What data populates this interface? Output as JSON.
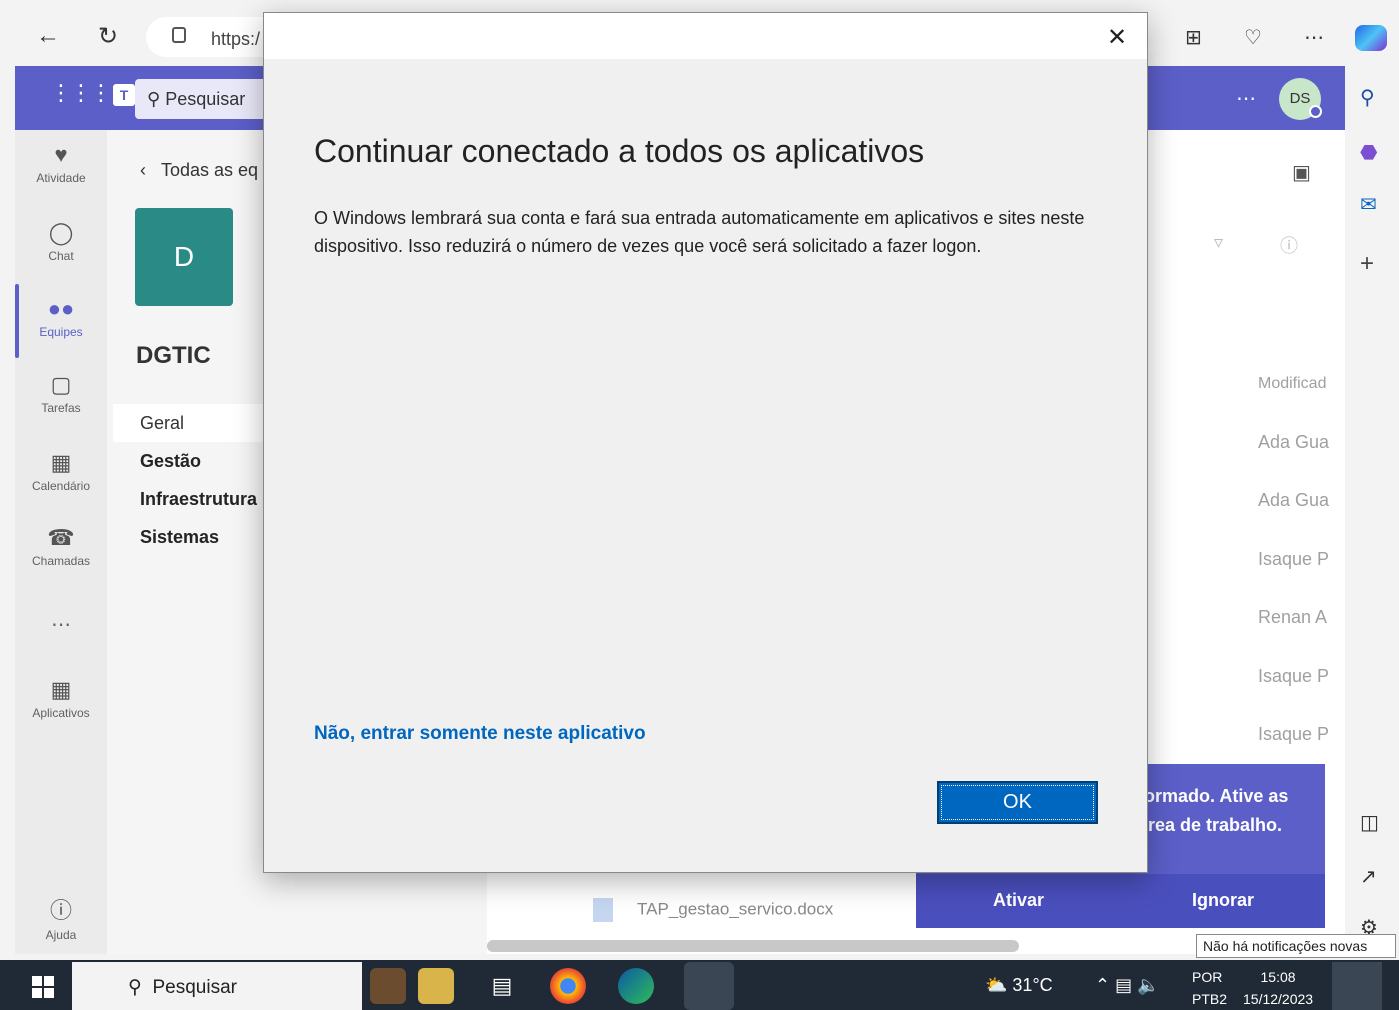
{
  "browser": {
    "url_text": "https:/",
    "back_icon": "arrow-left-icon",
    "refresh_icon": "refresh-icon"
  },
  "teams": {
    "search_placeholder": "Pesquisar",
    "avatar_initials": "DS",
    "rail": [
      {
        "label": "Atividade",
        "icon": "bell-icon"
      },
      {
        "label": "Chat",
        "icon": "chat-icon"
      },
      {
        "label": "Equipes",
        "icon": "teams-icon"
      },
      {
        "label": "Tarefas",
        "icon": "tasks-icon"
      },
      {
        "label": "Calendário",
        "icon": "calendar-icon"
      },
      {
        "label": "Chamadas",
        "icon": "phone-icon"
      },
      {
        "label": "Aplicativos",
        "icon": "apps-icon"
      },
      {
        "label": "Ajuda",
        "icon": "help-icon"
      }
    ],
    "back_label": "Todas as eq",
    "team_initial": "D",
    "team_name": "DGTIC",
    "channels": [
      "Geral",
      "Gestão",
      "Infraestrutura",
      "Sistemas"
    ]
  },
  "main": {
    "modified_header": "Modificad",
    "authors": [
      "Ada Gua",
      "Ada Gua",
      "Isaque P",
      "Renan A",
      "Isaque P",
      "Isaque P"
    ],
    "file_name": "TAP_gestao_servico.docx"
  },
  "activation": {
    "line1": "formado. Ative as",
    "line2": "área de trabalho.",
    "activate_label": "Ativar",
    "ignore_label": "Ignorar"
  },
  "modal": {
    "heading": "Continuar conectado a todos os aplicativos",
    "body": "O Windows lembrará sua conta e fará sua entrada automaticamente em aplicativos e sites neste dispositivo. Isso reduzirá o número de vezes que você será solicitado a fazer logon.",
    "link_label": "Não, entrar somente neste aplicativo",
    "ok_label": "OK"
  },
  "tooltip": "Não há notificações novas",
  "taskbar": {
    "search_label": "Pesquisar",
    "weather": "31°C",
    "lang_line1": "POR",
    "lang_line2": "PTB2",
    "time": "15:08",
    "date": "15/12/2023"
  }
}
